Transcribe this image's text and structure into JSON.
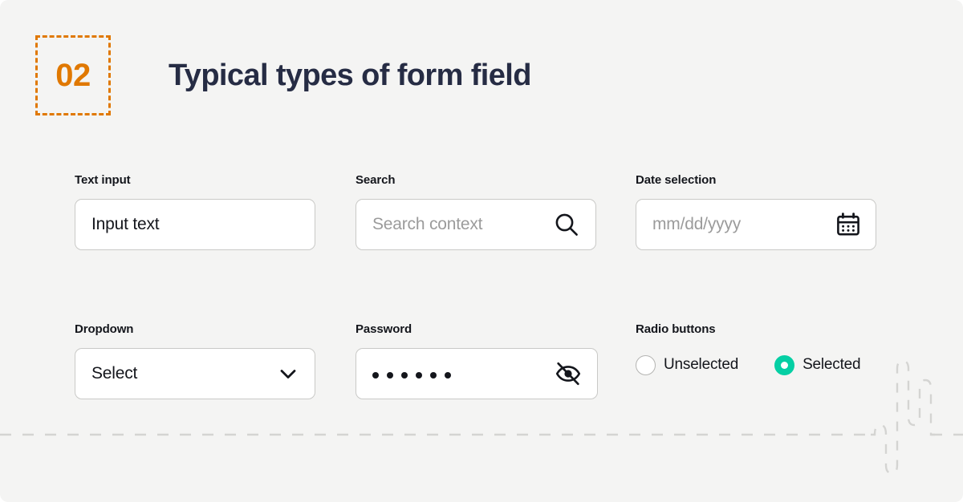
{
  "header": {
    "badge_number": "02",
    "title": "Typical types of form field"
  },
  "colors": {
    "background": "#f4f4f3",
    "accent_orange": "#e07800",
    "title_navy": "#262c44",
    "selected_teal": "#05cfa4",
    "border_gray": "#c9c9c7",
    "placeholder_gray": "#9b9b9b",
    "deco_dash": "#d4d4d2"
  },
  "fields": {
    "text_input": {
      "label": "Text input",
      "value": "Input text"
    },
    "search": {
      "label": "Search",
      "placeholder": "Search context",
      "icon": "search-icon"
    },
    "date": {
      "label": "Date selection",
      "placeholder": "mm/dd/yyyy",
      "icon": "calendar-icon"
    },
    "dropdown": {
      "label": "Dropdown",
      "value": "Select",
      "icon": "chevron-down-icon"
    },
    "password": {
      "label": "Password",
      "value": "••••••",
      "dot_count": 6,
      "icon": "eye-off-icon"
    },
    "radio": {
      "label": "Radio buttons",
      "options": [
        {
          "label": "Unselected",
          "selected": false
        },
        {
          "label": "Selected",
          "selected": true
        }
      ]
    }
  }
}
